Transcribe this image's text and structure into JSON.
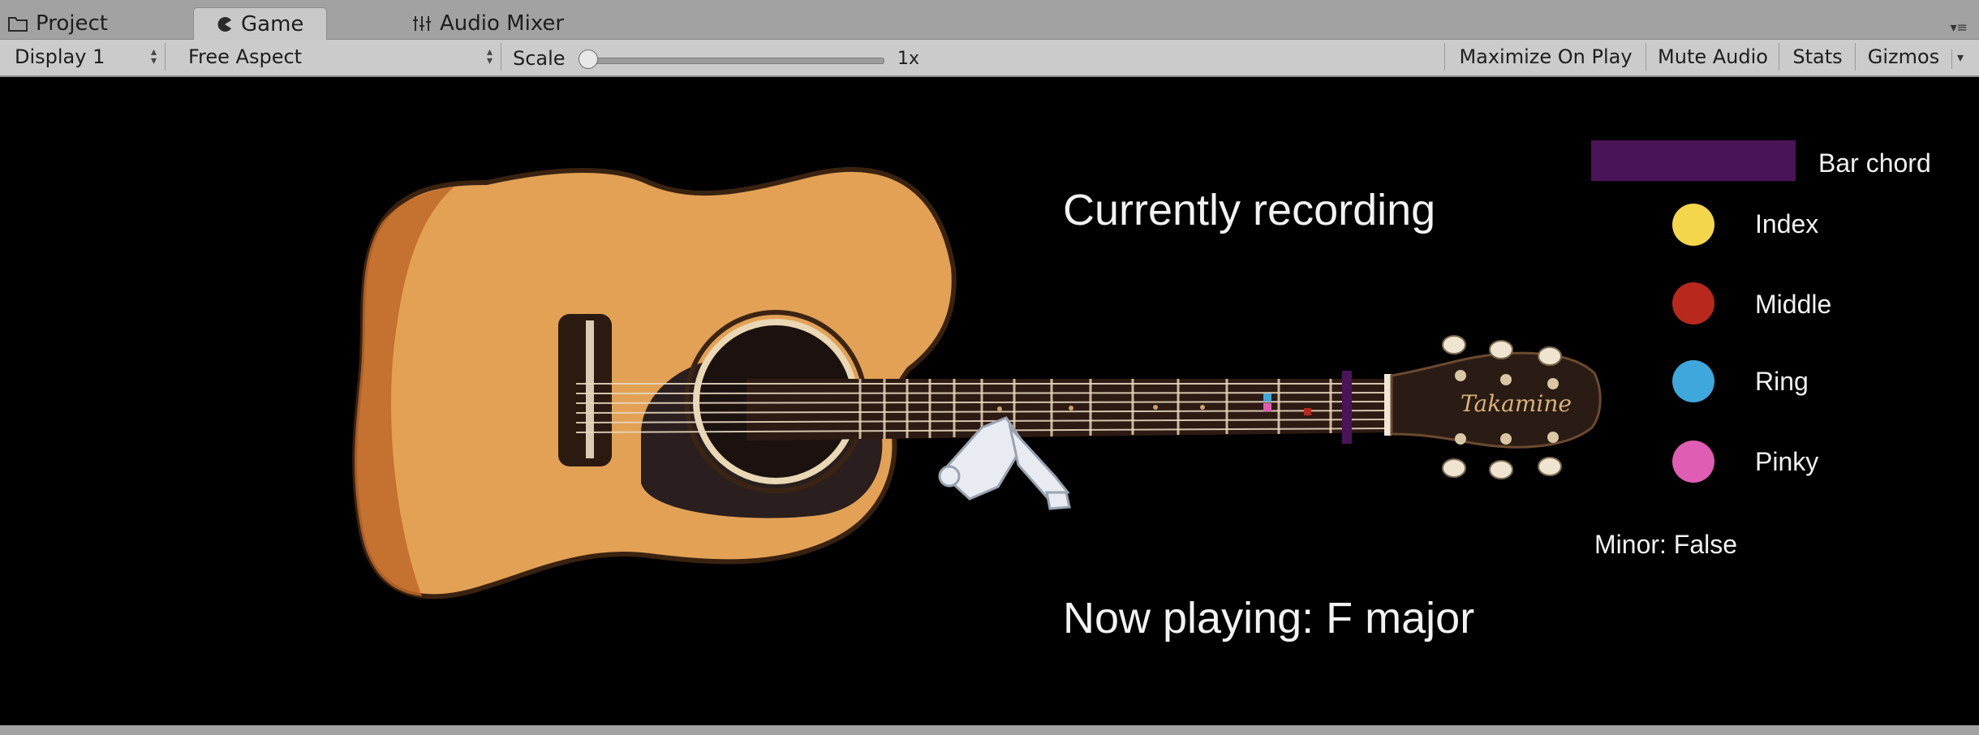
{
  "tabs": [
    {
      "label": "Project",
      "icon": "folder-icon"
    },
    {
      "label": "Game",
      "icon": "pacman-icon"
    },
    {
      "label": "Audio Mixer",
      "icon": "mixer-icon"
    }
  ],
  "toolbar": {
    "display": "Display 1",
    "aspect": "Free Aspect",
    "scale_label": "Scale",
    "scale_value": "1x",
    "maximize_on_play": "Maximize On Play",
    "mute_audio": "Mute Audio",
    "stats": "Stats",
    "gizmos": "Gizmos"
  },
  "game": {
    "status_text": "Currently recording",
    "now_playing": "Now playing: F major",
    "minor": "Minor: False",
    "legend": {
      "bar_chord": "Bar chord",
      "index": "Index",
      "middle": "Middle",
      "ring": "Ring",
      "pinky": "Pinky"
    }
  },
  "colors": {
    "bar_chord": "#4a1458",
    "index": "#f3d64c",
    "middle": "#b8281d",
    "ring": "#3ea8dc",
    "pinky": "#e05db4"
  }
}
